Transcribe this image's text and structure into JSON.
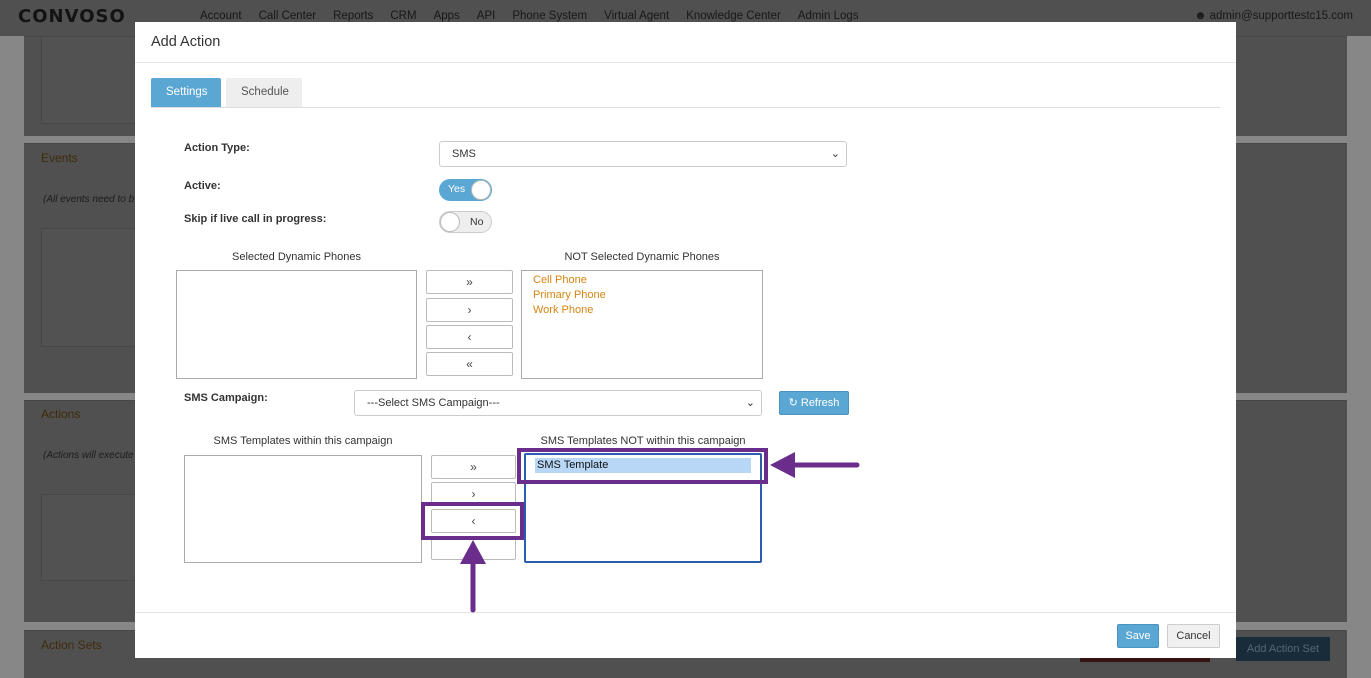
{
  "background": {
    "logo": "CONVOSO",
    "nav": [
      "Account",
      "Call Center",
      "Reports",
      "CRM",
      "Apps",
      "API",
      "Phone System",
      "Virtual Agent",
      "Knowledge Center",
      "Admin Logs"
    ],
    "user": "admin@supporttestc15.com",
    "sections": {
      "events_title": "Events",
      "events_note": "(All events need to b",
      "actions_title": "Actions",
      "actions_note": "(Actions will execute",
      "action_sets_title": "Action Sets",
      "add_action_set_label": "Add Action Set"
    }
  },
  "modal": {
    "title": "Add Action",
    "tabs": [
      {
        "label": "Settings",
        "active": true
      },
      {
        "label": "Schedule",
        "active": false
      }
    ],
    "action_type": {
      "label": "Action Type:",
      "value": "SMS"
    },
    "active": {
      "label": "Active:",
      "value": "Yes",
      "on": true
    },
    "skip_live_call": {
      "label": "Skip if live call in progress:",
      "value": "No",
      "on": false
    },
    "dynamic_phones": {
      "selected_caption": "Selected Dynamic Phones",
      "not_selected_caption": "NOT Selected Dynamic Phones",
      "selected": [],
      "not_selected": [
        "Cell Phone",
        "Primary Phone",
        "Work Phone"
      ]
    },
    "sms_campaign": {
      "label": "SMS Campaign:",
      "placeholder": "---Select SMS Campaign---",
      "refresh_label": "Refresh"
    },
    "sms_templates": {
      "within_caption": "SMS Templates within this campaign",
      "not_within_caption": "SMS Templates NOT within this campaign",
      "within": [],
      "not_within": [
        "SMS Template"
      ]
    },
    "move_buttons": {
      "move_all_right": "»",
      "move_right": "›",
      "move_left": "‹",
      "move_all_left": "«"
    },
    "footer": {
      "save_label": "Save",
      "cancel_label": "Cancel"
    }
  },
  "colors": {
    "primary": "#5ba7d4",
    "highlight": "#6b2d8b",
    "option_text": "#d58512"
  }
}
